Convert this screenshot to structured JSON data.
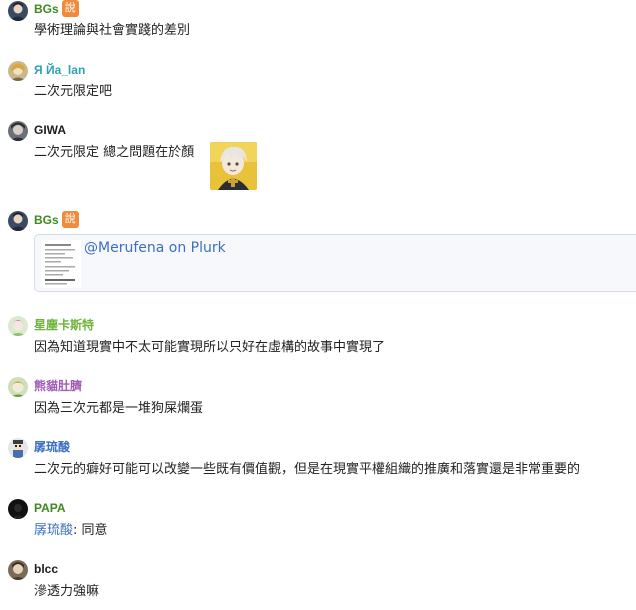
{
  "colors": {
    "name_green": "#3d8b1e",
    "name_teal": "#2ea3b0",
    "name_black": "#1d1d1d",
    "name_lightgreen": "#6fb23a",
    "name_purple": "#a25bb8",
    "name_blue": "#3b6fc0",
    "badge_orange": "#f08a3c",
    "link_blue": "#3b6fc0"
  },
  "messages": [
    {
      "user": "BGs",
      "badge": "說",
      "text": "學術理論與社會實踐的差別"
    },
    {
      "user": "Я Йа_lan",
      "text": "二次元限定吧"
    },
    {
      "user": "GIWA",
      "text": "二次元限定 總之問題在於顏",
      "sticker_icon": "anime-character-sticker"
    },
    {
      "user": "BGs",
      "badge": "說",
      "link_card": {
        "text": "@Merufena on Plurk"
      }
    },
    {
      "user": "星塵卡斯特",
      "text": "因為知道現實中不太可能實現所以只好在虛構的故事中實現了"
    },
    {
      "user": "熊貓肚臍",
      "text": "因為三次元都是一堆狗屎爛蛋"
    },
    {
      "user": "孱琉酸",
      "text": "二次元的癖好可能可以改變一些既有價值觀，但是在現實平權組織的推廣和落實還是非常重要的"
    },
    {
      "user": "PAPA",
      "mention": "孱琉酸",
      "text": ": 同意"
    },
    {
      "user": "blcc",
      "text": "滲透力強嘛"
    }
  ]
}
